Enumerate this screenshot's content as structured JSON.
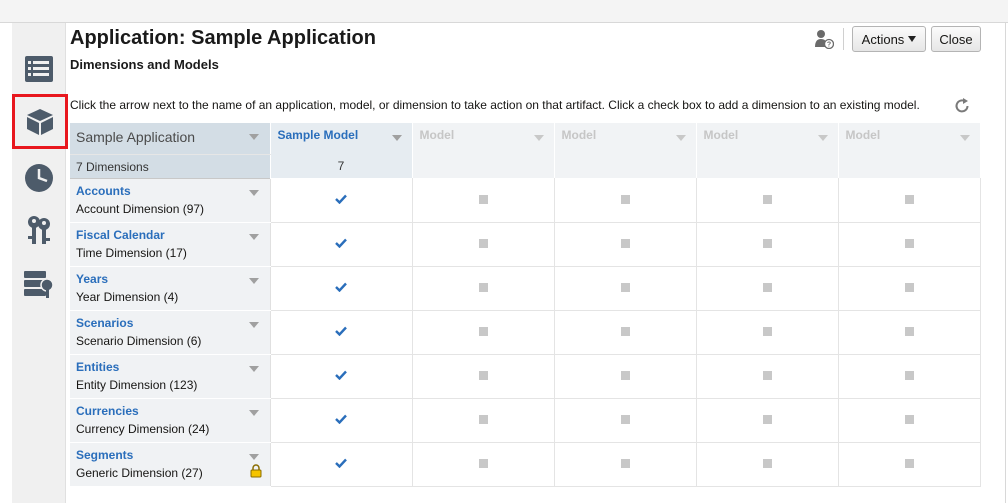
{
  "page": {
    "title": "Application: Sample Application",
    "subtitle": "Dimensions and Models",
    "instructions": "Click the arrow next to the name of an application, model, or dimension to take action on that artifact. Click a check box to add a dimension to an existing model."
  },
  "toolbar": {
    "actions_label": "Actions",
    "close_label": "Close"
  },
  "sidebar": {
    "items": [
      {
        "name": "overview",
        "icon": "list-icon"
      },
      {
        "name": "dimensions-models",
        "icon": "cube-icon",
        "selected": true
      },
      {
        "name": "history",
        "icon": "clock-icon"
      },
      {
        "name": "security",
        "icon": "keys-icon"
      },
      {
        "name": "databases",
        "icon": "database-key-icon"
      }
    ]
  },
  "grid": {
    "application_label": "Sample Application",
    "dimension_count": "7",
    "dimension_count_label": "Dimensions",
    "models": [
      {
        "name": "Sample Model",
        "count": "7",
        "active": true
      },
      {
        "name": "Model",
        "count": "",
        "active": false
      },
      {
        "name": "Model",
        "count": "",
        "active": false
      },
      {
        "name": "Model",
        "count": "",
        "active": false
      },
      {
        "name": "Model",
        "count": "",
        "active": false
      }
    ],
    "rows": [
      {
        "name": "Accounts",
        "type": "Account Dimension",
        "count": "(97)",
        "cells": [
          true,
          false,
          false,
          false,
          false
        ],
        "locked": false
      },
      {
        "name": "Fiscal Calendar",
        "type": "Time Dimension",
        "count": "(17)",
        "cells": [
          true,
          false,
          false,
          false,
          false
        ],
        "locked": false
      },
      {
        "name": "Years",
        "type": "Year Dimension",
        "count": "(4)",
        "cells": [
          true,
          false,
          false,
          false,
          false
        ],
        "locked": false
      },
      {
        "name": "Scenarios",
        "type": "Scenario Dimension",
        "count": "(6)",
        "cells": [
          true,
          false,
          false,
          false,
          false
        ],
        "locked": false
      },
      {
        "name": "Entities",
        "type": "Entity Dimension",
        "count": "(123)",
        "cells": [
          true,
          false,
          false,
          false,
          false
        ],
        "locked": false
      },
      {
        "name": "Currencies",
        "type": "Currency Dimension",
        "count": "(24)",
        "cells": [
          true,
          false,
          false,
          false,
          false
        ],
        "locked": false
      },
      {
        "name": "Segments",
        "type": "Generic Dimension",
        "count": "(27)",
        "cells": [
          true,
          false,
          false,
          false,
          false
        ],
        "locked": true
      }
    ]
  },
  "colors": {
    "accent": "#2a6ebb",
    "selection_outline": "#e8171e",
    "header_bg": "#d3dde5",
    "check": "#2a6ebb"
  }
}
